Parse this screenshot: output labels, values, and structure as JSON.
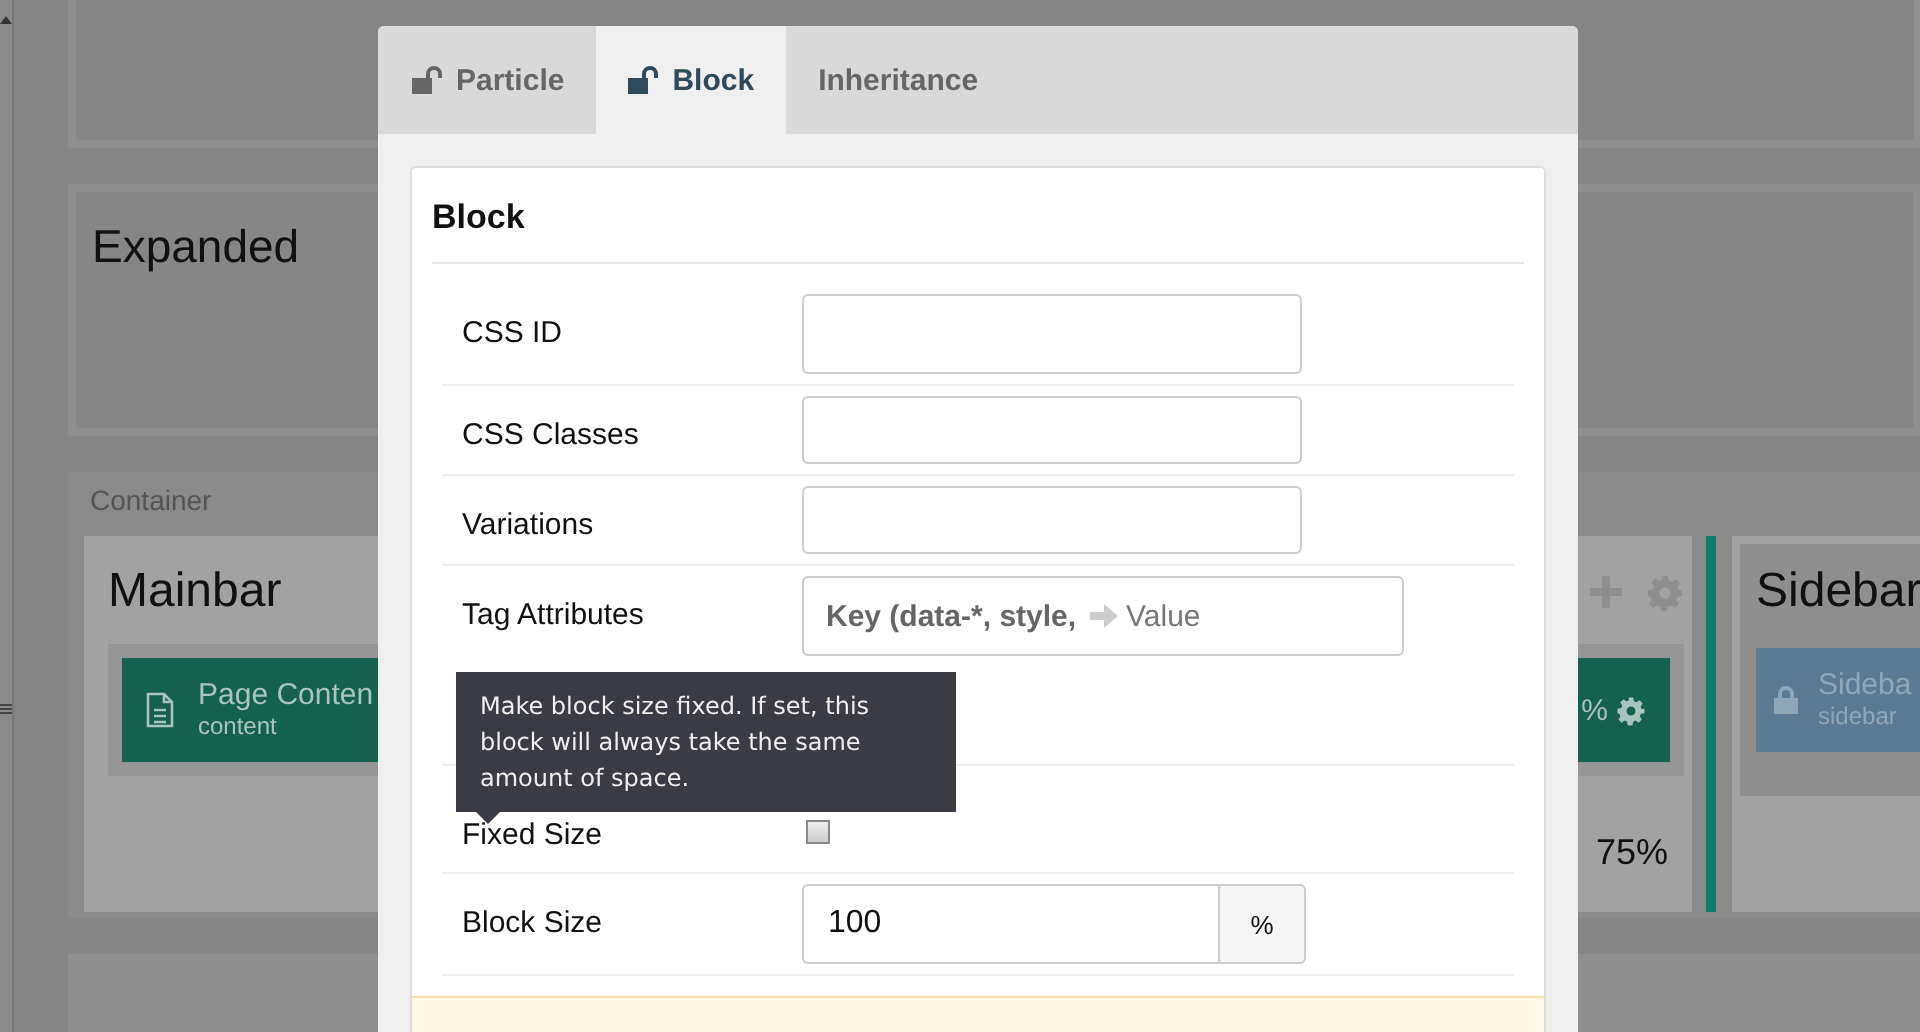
{
  "background": {
    "expanded": {
      "title": "Expanded"
    },
    "container": {
      "label": "Container",
      "mainbar": {
        "title": "Mainbar",
        "block": {
          "title": "Page Conten",
          "subtitle": "content"
        },
        "size_block": {
          "text": "%"
        },
        "size": "75%"
      },
      "sidebar": {
        "title": "Sidebar",
        "block": {
          "title": "Sideba",
          "subtitle": "sidebar"
        }
      }
    }
  },
  "modal": {
    "tabs": [
      {
        "label": "Particle",
        "kind": "lock",
        "selected": false
      },
      {
        "label": "Block",
        "kind": "lock",
        "selected": true
      },
      {
        "label": "Inheritance",
        "kind": "plain",
        "selected": false
      }
    ],
    "panel": {
      "title": "Block",
      "fields": [
        {
          "kind": "text",
          "label": "CSS ID"
        },
        {
          "kind": "text",
          "label": "CSS Classes"
        },
        {
          "kind": "text",
          "label": "Variations"
        },
        {
          "kind": "key-value",
          "label": "Tag Attributes",
          "key_placeholder": "Key (data-*, style,",
          "value_placeholder": "Value"
        },
        {
          "kind": "checkbox",
          "label": "Fixed Size",
          "checked": false
        },
        {
          "kind": "number-addon",
          "label": "Block Size",
          "value": "100",
          "addon": "%"
        }
      ]
    },
    "tooltip": "Make block size fixed. If set, this block will always take the same amount of space."
  }
}
